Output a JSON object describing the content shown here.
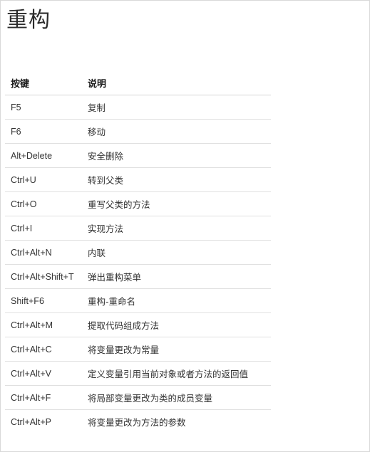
{
  "title": "重构",
  "table": {
    "headers": {
      "key": "按键",
      "description": "说明"
    },
    "rows": [
      {
        "key": "F5",
        "description": "复制"
      },
      {
        "key": "F6",
        "description": "移动"
      },
      {
        "key": "Alt+Delete",
        "description": "安全删除"
      },
      {
        "key": "Ctrl+U",
        "description": "转到父类"
      },
      {
        "key": "Ctrl+O",
        "description": "重写父类的方法"
      },
      {
        "key": "Ctrl+I",
        "description": "实现方法"
      },
      {
        "key": "Ctrl+Alt+N",
        "description": "内联"
      },
      {
        "key": "Ctrl+Alt+Shift+T",
        "description": "弹出重构菜单"
      },
      {
        "key": "Shift+F6",
        "description": "重构-重命名"
      },
      {
        "key": "Ctrl+Alt+M",
        "description": "提取代码组成方法"
      },
      {
        "key": "Ctrl+Alt+C",
        "description": "将变量更改为常量"
      },
      {
        "key": "Ctrl+Alt+V",
        "description": "定义变量引用当前对象或者方法的返回值"
      },
      {
        "key": "Ctrl+Alt+F",
        "description": "将局部变量更改为类的成员变量"
      },
      {
        "key": "Ctrl+Alt+P",
        "description": "将变量更改为方法的参数"
      }
    ]
  }
}
